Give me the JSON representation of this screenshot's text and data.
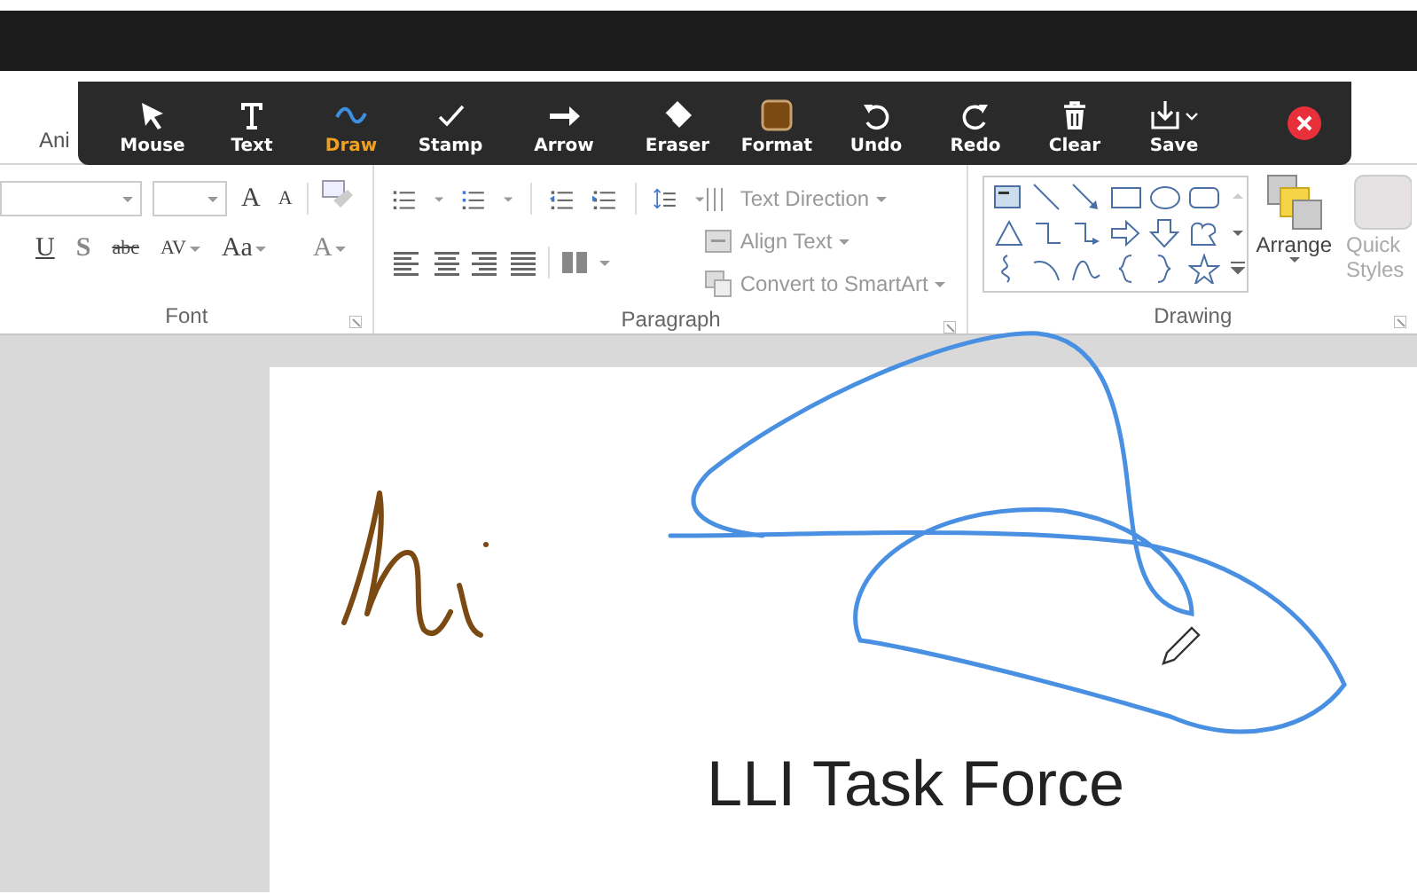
{
  "annotation_toolbar": {
    "tools": [
      {
        "label": "Mouse",
        "kind": "mouse",
        "selected": false
      },
      {
        "label": "Text",
        "kind": "text",
        "selected": false
      },
      {
        "label": "Draw",
        "kind": "draw",
        "selected": true
      },
      {
        "label": "Stamp",
        "kind": "stamp",
        "selected": false
      },
      {
        "label": "Arrow",
        "kind": "arrow",
        "selected": false
      },
      {
        "label": "Eraser",
        "kind": "eraser",
        "selected": false
      },
      {
        "label": "Format",
        "kind": "format",
        "selected": false
      },
      {
        "label": "Undo",
        "kind": "undo",
        "selected": false
      },
      {
        "label": "Redo",
        "kind": "redo",
        "selected": false
      },
      {
        "label": "Clear",
        "kind": "clear",
        "selected": false
      },
      {
        "label": "Save",
        "kind": "save",
        "selected": false
      }
    ]
  },
  "ribbon": {
    "tab": "Ani",
    "font": {
      "label": "Font",
      "grow": "A",
      "shrink": "A",
      "underline": "U",
      "shadow": "S",
      "strikethrough": "abc",
      "spacing": "AV",
      "change_case": "Aa",
      "font_color": "A"
    },
    "paragraph": {
      "label": "Paragraph",
      "commands": [
        "Text Direction",
        "Align Text",
        "Convert to SmartArt"
      ]
    },
    "drawing": {
      "label": "Drawing",
      "arrange": "Arrange",
      "quick_styles": "Quick Styles"
    }
  },
  "slide": {
    "title": "LLI Task Force"
  }
}
